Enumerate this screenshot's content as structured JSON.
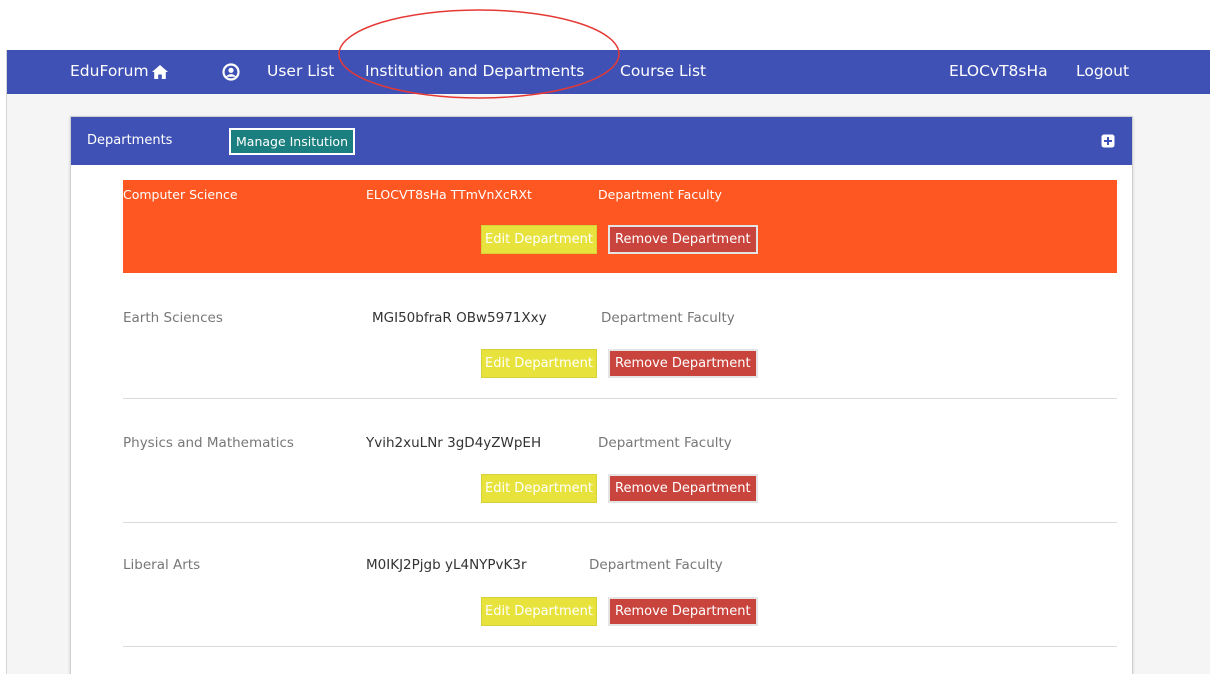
{
  "navbar": {
    "brand": "EduForum",
    "home_icon": "home-icon",
    "profile_icon": "user-circle-icon",
    "links": [
      "User List",
      "Institution and Departments",
      "Course List"
    ],
    "username": "ELOCvT8sHa",
    "logout": "Logout",
    "color": "#3f51b5"
  },
  "panel": {
    "title": "Departments",
    "manage_label": "Manage Insitution",
    "expand_icon": "plus-square-icon"
  },
  "departments": [
    {
      "name": "Computer Science",
      "code": "ELOCVT8sHa TTmVnXcRXt",
      "faculty": "Department Faculty",
      "edit": "Edit Department",
      "remove": "Remove Department",
      "selected": true
    },
    {
      "name": "Earth Sciences",
      "code": "MGI50bfraR OBw5971Xxy",
      "faculty": "Department Faculty",
      "edit": "Edit Department",
      "remove": "Remove Department",
      "selected": false
    },
    {
      "name": "Physics and Mathematics",
      "code": "Yvih2xuLNr 3gD4yZWpEH",
      "faculty": "Department Faculty",
      "edit": "Edit Department",
      "remove": "Remove Department",
      "selected": false
    },
    {
      "name": "Liberal Arts",
      "code": "M0IKJ2Pjgb yL4NYPvK3r",
      "faculty": "Department Faculty",
      "edit": "Edit Department",
      "remove": "Remove Department",
      "selected": false
    }
  ],
  "colors": {
    "selected_row": "#ff5722",
    "edit_button": "#e7e33c",
    "remove_button": "#c9443c",
    "manage_button": "#1b7f7f",
    "annotation": "#e53935"
  }
}
